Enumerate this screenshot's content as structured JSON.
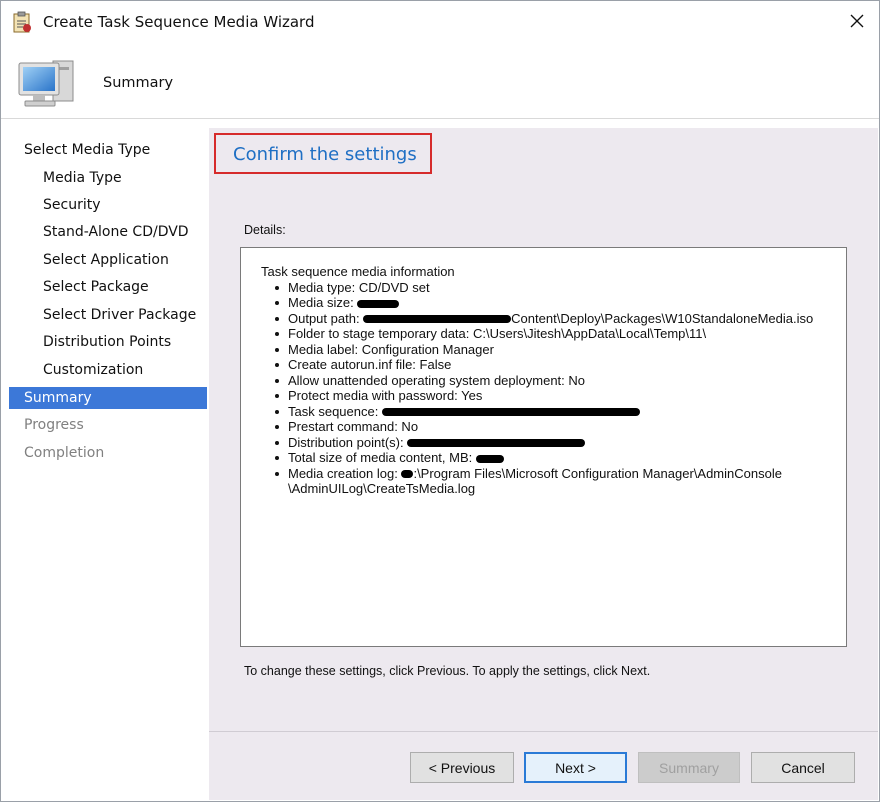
{
  "window": {
    "title": "Create Task Sequence Media Wizard",
    "close_glyph": "✕",
    "app_icon": "wizard-clipboard-icon"
  },
  "header": {
    "title": "Summary",
    "icon": "computer-monitor-icon"
  },
  "nav": {
    "items": [
      {
        "label": "Select Media Type",
        "level": "top",
        "state": "normal"
      },
      {
        "label": "Media Type",
        "level": "sub",
        "state": "normal"
      },
      {
        "label": "Security",
        "level": "sub",
        "state": "normal"
      },
      {
        "label": "Stand-Alone CD/DVD",
        "level": "sub",
        "state": "normal"
      },
      {
        "label": "Select Application",
        "level": "sub",
        "state": "normal"
      },
      {
        "label": "Select Package",
        "level": "sub",
        "state": "normal"
      },
      {
        "label": "Select Driver Package",
        "level": "sub",
        "state": "normal"
      },
      {
        "label": "Distribution Points",
        "level": "sub",
        "state": "normal"
      },
      {
        "label": "Customization",
        "level": "sub",
        "state": "normal"
      },
      {
        "label": "Summary",
        "level": "top",
        "state": "active"
      },
      {
        "label": "Progress",
        "level": "top",
        "state": "disabled"
      },
      {
        "label": "Completion",
        "level": "top",
        "state": "disabled"
      }
    ]
  },
  "main": {
    "heading": "Confirm the settings",
    "details_label": "Details:",
    "details": {
      "header": "Task sequence media information",
      "items": [
        {
          "label": "Media type: CD/DVD set",
          "value": ""
        },
        {
          "label": "Media size: ",
          "value": ""
        },
        {
          "label": "Output path: ",
          "value": "Content\\Deploy\\Packages\\W10StandaloneMedia.iso"
        },
        {
          "label": "Folder to stage temporary data: C:\\Users\\Jitesh\\AppData\\Local\\Temp\\11\\",
          "value": ""
        },
        {
          "label": "Media label: Configuration Manager",
          "value": ""
        },
        {
          "label": "Create autorun.inf file: False",
          "value": ""
        },
        {
          "label": "Allow unattended operating system deployment: No",
          "value": ""
        },
        {
          "label": "Protect media with password: Yes",
          "value": ""
        },
        {
          "label": "Task sequence: ",
          "value": ""
        },
        {
          "label": "Prestart command: No",
          "value": ""
        },
        {
          "label": "Distribution point(s): ",
          "value": ""
        },
        {
          "label": "Total size of media content, MB: ",
          "value": ""
        },
        {
          "label": "Media creation log: ",
          "value": ":\\Program Files\\Microsoft Configuration Manager\\AdminConsole"
        }
      ],
      "continuation": "\\AdminUILog\\CreateTsMedia.log"
    },
    "footnote": "To change these settings, click Previous. To apply the settings, click Next."
  },
  "buttons": {
    "previous": "< Previous",
    "next": "Next >",
    "summary": "Summary",
    "cancel": "Cancel"
  },
  "colors": {
    "accent": "#3c78d8",
    "heading": "#1f6fc4",
    "highlight_border": "#d62b2b",
    "content_bg": "#ede9ef"
  }
}
